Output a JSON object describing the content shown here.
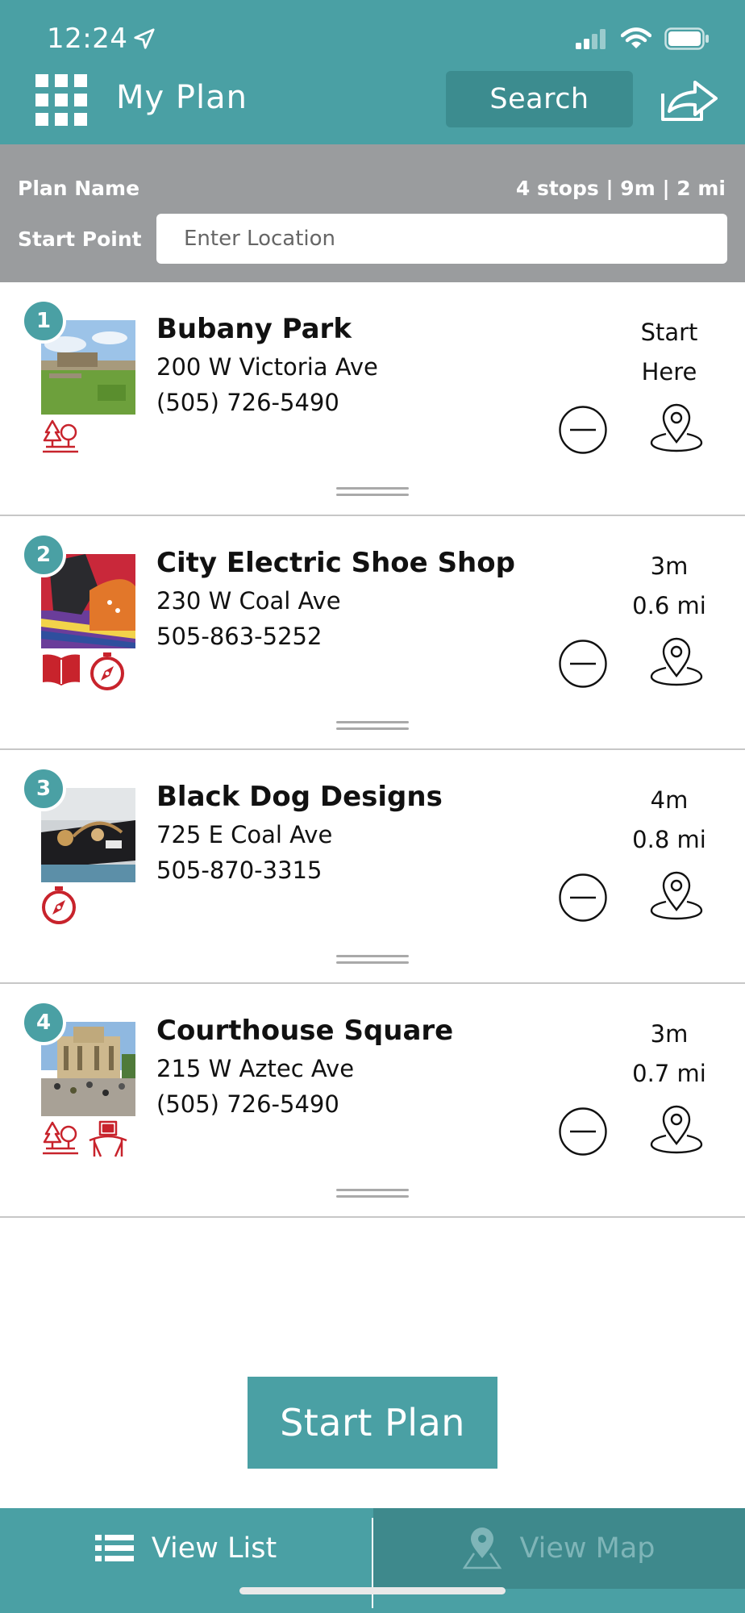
{
  "status_bar": {
    "time": "12:24"
  },
  "header": {
    "title": "My Plan",
    "search_label": "Search"
  },
  "plan": {
    "name_label": "Plan Name",
    "stats": "4 stops | 9m | 2 mi",
    "start_label": "Start Point",
    "start_placeholder": "Enter Location"
  },
  "stops": [
    {
      "number": "1",
      "name": "Bubany Park",
      "address": "200 W Victoria Ave",
      "phone": "(505) 726-5490",
      "time": "Start",
      "distance": "Here",
      "categories": [
        "park-icon"
      ]
    },
    {
      "number": "2",
      "name": "City Electric Shoe Shop",
      "address": "230 W Coal Ave",
      "phone": "505-863-5252",
      "time": "3m",
      "distance": "0.6 mi",
      "categories": [
        "book-icon",
        "compass-icon"
      ]
    },
    {
      "number": "3",
      "name": "Black Dog Designs",
      "address": "725 E Coal Ave",
      "phone": "505-870-3315",
      "time": "4m",
      "distance": "0.8 mi",
      "categories": [
        "compass-icon"
      ]
    },
    {
      "number": "4",
      "name": "Courthouse Square",
      "address": "215 W Aztec Ave",
      "phone": "(505) 726-5490",
      "time": "3m",
      "distance": "0.7 mi",
      "categories": [
        "park-icon",
        "museum-icon"
      ]
    }
  ],
  "actions": {
    "start_plan": "Start Plan"
  },
  "tabs": {
    "list": "View List",
    "map": "View Map"
  },
  "colors": {
    "brand": "#4aa0a4",
    "brand_dark": "#3c8c8f",
    "plan_bar": "#9a9c9e",
    "category_red": "#c8232c"
  }
}
